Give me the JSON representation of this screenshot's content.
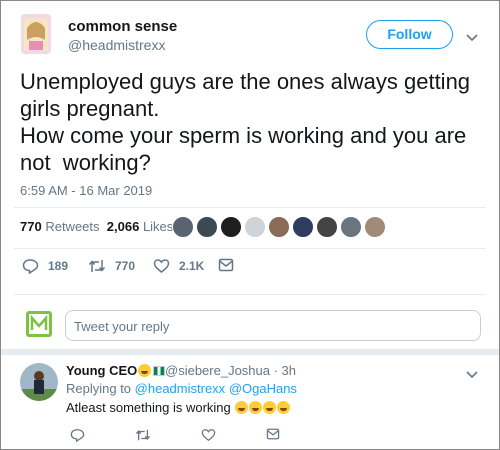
{
  "tweet": {
    "author_name": "common sense",
    "author_handle": "@headmistrexx",
    "follow_label": "Follow",
    "text_lines": [
      "Unemployed guys are the ones always getting",
      "girls pregnant.",
      "How come your sperm is working and you are",
      "not  working?"
    ],
    "timestamp": "6:59 AM - 16 Mar 2019",
    "retweets_count": "770",
    "retweets_label": "Retweets",
    "likes_count": "2,066",
    "likes_label": "Likes",
    "actions": {
      "replies": "189",
      "retweets": "770",
      "likes": "2.1K"
    }
  },
  "reply_box": {
    "placeholder": "Tweet your reply"
  },
  "reply": {
    "author_name": "Young CEO",
    "author_handle": "@siebere_Joshua",
    "time": "· 3h",
    "replying_prefix": "Replying to",
    "mention_1": "@headmistrexx",
    "mention_2": "@OgaHans",
    "text": "Atleast something is working"
  },
  "colors": {
    "accent": "#1da1f2",
    "muted": "#657786",
    "text": "#14171a"
  },
  "icons": [
    "chevron-down-icon",
    "reply-icon",
    "retweet-icon",
    "heart-icon",
    "dm-icon"
  ]
}
